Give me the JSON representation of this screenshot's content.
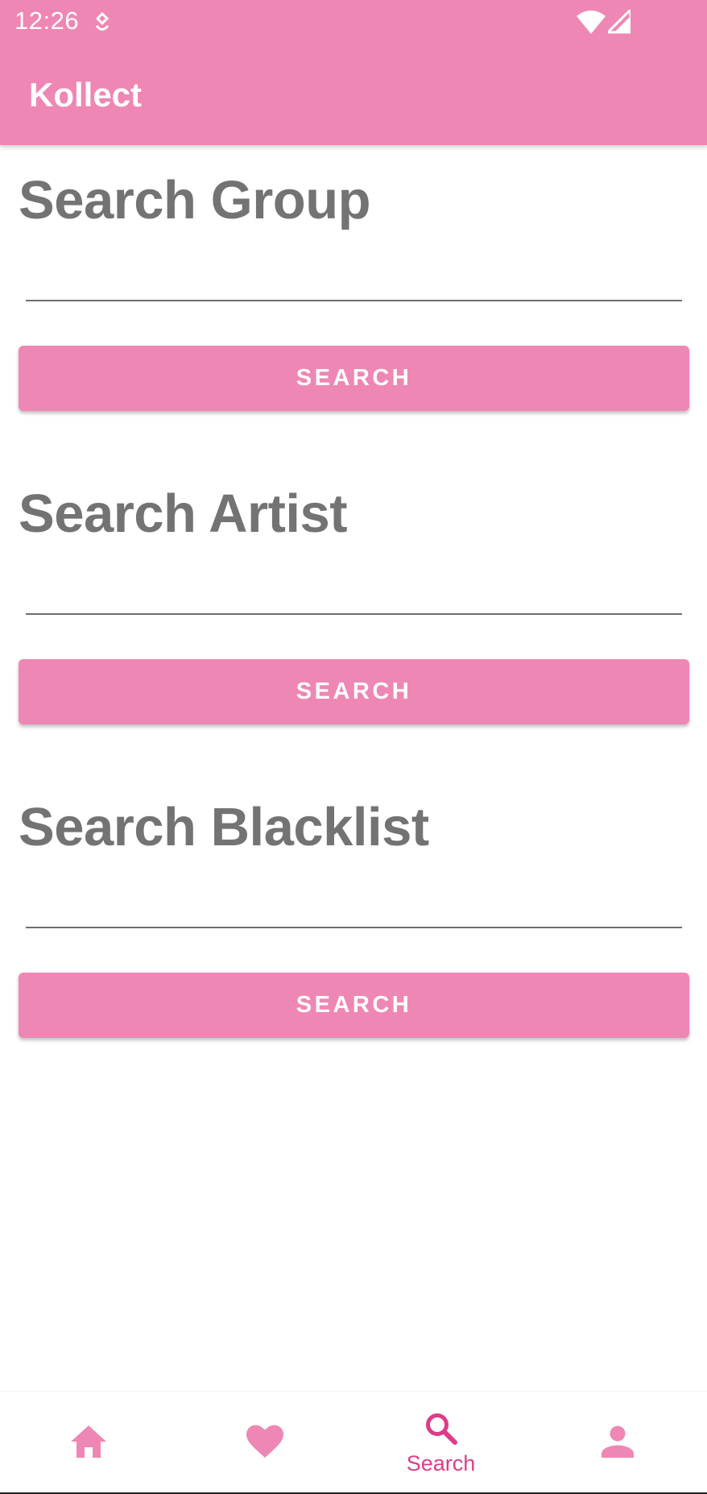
{
  "status_bar": {
    "time": "12:26",
    "icons": [
      "notification-icon",
      "wifi-icon",
      "signal-icon"
    ]
  },
  "app_bar": {
    "title": "Kollect"
  },
  "sections": [
    {
      "title": "Search Group",
      "input_value": "",
      "button_label": "SEARCH"
    },
    {
      "title": "Search Artist",
      "input_value": "",
      "button_label": "SEARCH"
    },
    {
      "title": "Search Blacklist",
      "input_value": "",
      "button_label": "SEARCH"
    }
  ],
  "bottom_nav": {
    "items": [
      {
        "icon": "home-icon",
        "label": "",
        "selected": false
      },
      {
        "icon": "heart-icon",
        "label": "",
        "selected": false
      },
      {
        "icon": "search-icon",
        "label": "Search",
        "selected": true
      },
      {
        "icon": "person-icon",
        "label": "",
        "selected": false
      }
    ]
  },
  "colors": {
    "primary": "#ee87b4",
    "selected_nav": "#dd3d88",
    "heading_text": "#737373",
    "background": "#ffffff"
  }
}
